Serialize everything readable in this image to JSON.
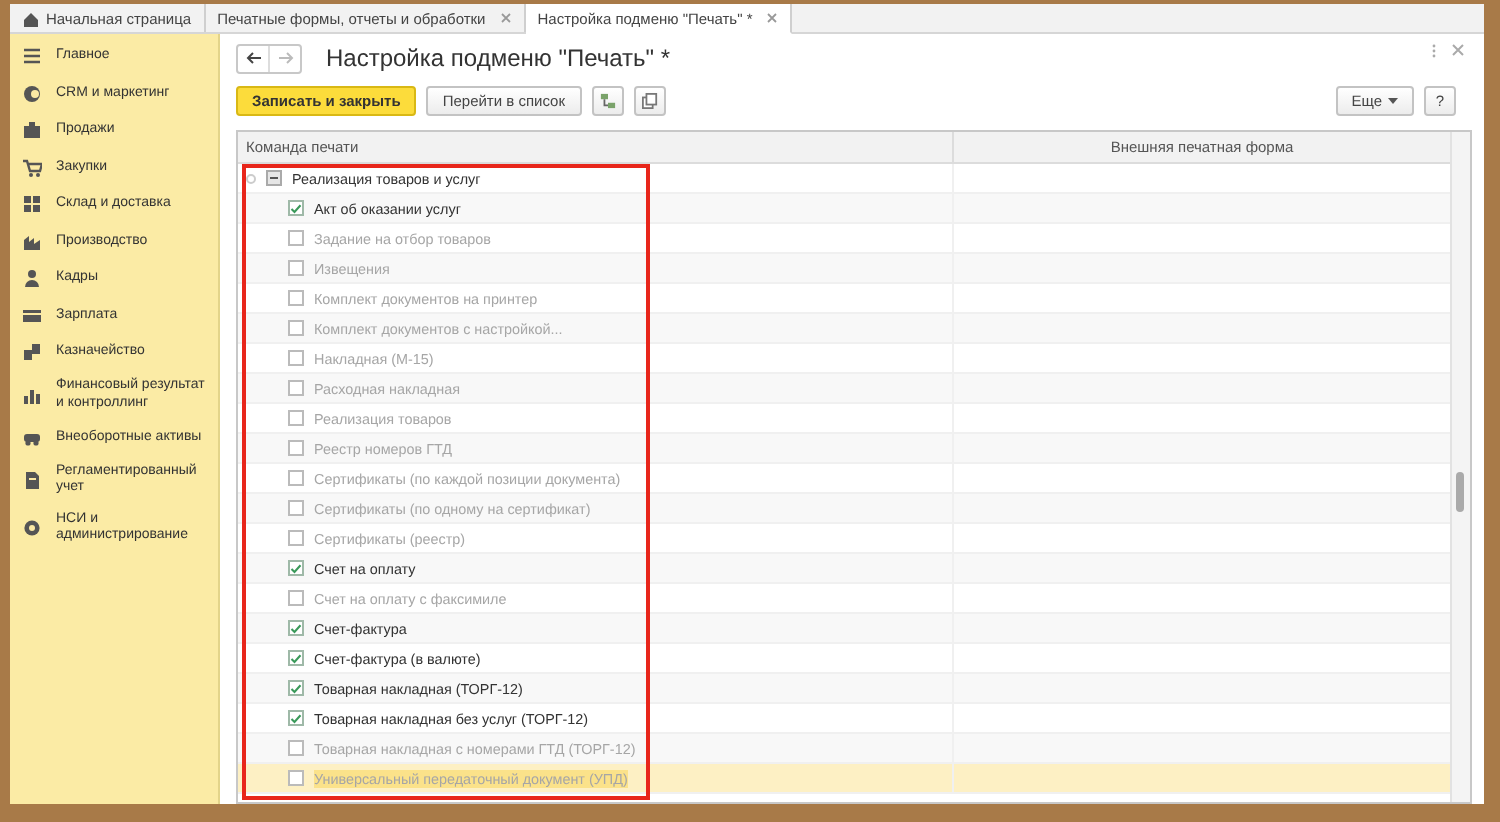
{
  "tabs": [
    {
      "label": "Начальная страница",
      "selected": false,
      "closable": false,
      "home": true
    },
    {
      "label": "Печатные формы, отчеты и обработки",
      "selected": false,
      "closable": true,
      "home": false
    },
    {
      "label": "Настройка подменю \"Печать\" *",
      "selected": true,
      "closable": true,
      "home": false
    }
  ],
  "sidebar": {
    "items": [
      {
        "label": "Главное"
      },
      {
        "label": "CRM и маркетинг"
      },
      {
        "label": "Продажи"
      },
      {
        "label": "Закупки"
      },
      {
        "label": "Склад и доставка"
      },
      {
        "label": "Производство"
      },
      {
        "label": "Кадры"
      },
      {
        "label": "Зарплата"
      },
      {
        "label": "Казначейство"
      },
      {
        "label": "Финансовый результат и контроллинг"
      },
      {
        "label": "Внеоборотные активы"
      },
      {
        "label": "Регламентированный учет"
      },
      {
        "label": "НСИ и администрирование"
      }
    ]
  },
  "window": {
    "title": "Настройка подменю \"Печать\" *"
  },
  "toolbar": {
    "buttons": [
      {
        "kind": "primary",
        "label": "Записать и закрыть"
      },
      {
        "kind": "plain",
        "label": "Перейти в список"
      },
      {
        "kind": "icon-tree"
      },
      {
        "kind": "icon-copy"
      }
    ],
    "more": "Еще",
    "help": "?"
  },
  "table": {
    "columns": [
      "Команда печати",
      "Внешняя печатная форма"
    ],
    "rows": [
      {
        "command": "Реализация товаров и услуг",
        "expanded": true,
        "children": [
          {
            "command": "Акт об оказании услуг",
            "checked": true,
            "selected": false
          },
          {
            "command": "Задание на отбор товаров",
            "checked": false,
            "selected": false
          },
          {
            "command": "Извещения",
            "checked": false,
            "selected": false
          },
          {
            "command": "Комплект документов на принтер",
            "checked": false,
            "selected": false
          },
          {
            "command": "Комплект документов с настройкой...",
            "checked": false,
            "selected": false
          },
          {
            "command": "Накладная (М-15)",
            "checked": false,
            "selected": false
          },
          {
            "command": "Расходная накладная",
            "checked": false,
            "selected": false
          },
          {
            "command": "Реализация товаров",
            "checked": false,
            "selected": false
          },
          {
            "command": "Реестр номеров ГТД",
            "checked": false,
            "selected": false
          },
          {
            "command": "Сертификаты (по каждой позиции документа)",
            "checked": false,
            "selected": false
          },
          {
            "command": "Сертификаты (по одному на сертификат)",
            "checked": false,
            "selected": false
          },
          {
            "command": "Сертификаты (реестр)",
            "checked": false,
            "selected": false
          },
          {
            "command": "Счет на оплату",
            "checked": true,
            "selected": false
          },
          {
            "command": "Счет на оплату с факсимиле",
            "checked": false,
            "selected": false
          },
          {
            "command": "Счет-фактура",
            "checked": true,
            "selected": false
          },
          {
            "command": "Счет-фактура (в валюте)",
            "checked": true,
            "selected": false
          },
          {
            "command": "Товарная накладная (ТОРГ-12)",
            "checked": true,
            "selected": false
          },
          {
            "command": "Товарная накладная без услуг (ТОРГ-12)",
            "checked": true,
            "selected": false
          },
          {
            "command": "Товарная накладная с номерами ГТД (ТОРГ-12)",
            "checked": false,
            "selected": false
          },
          {
            "command": "Универсальный передаточный документ (УПД)",
            "checked": false,
            "selected": true
          }
        ]
      }
    ]
  }
}
